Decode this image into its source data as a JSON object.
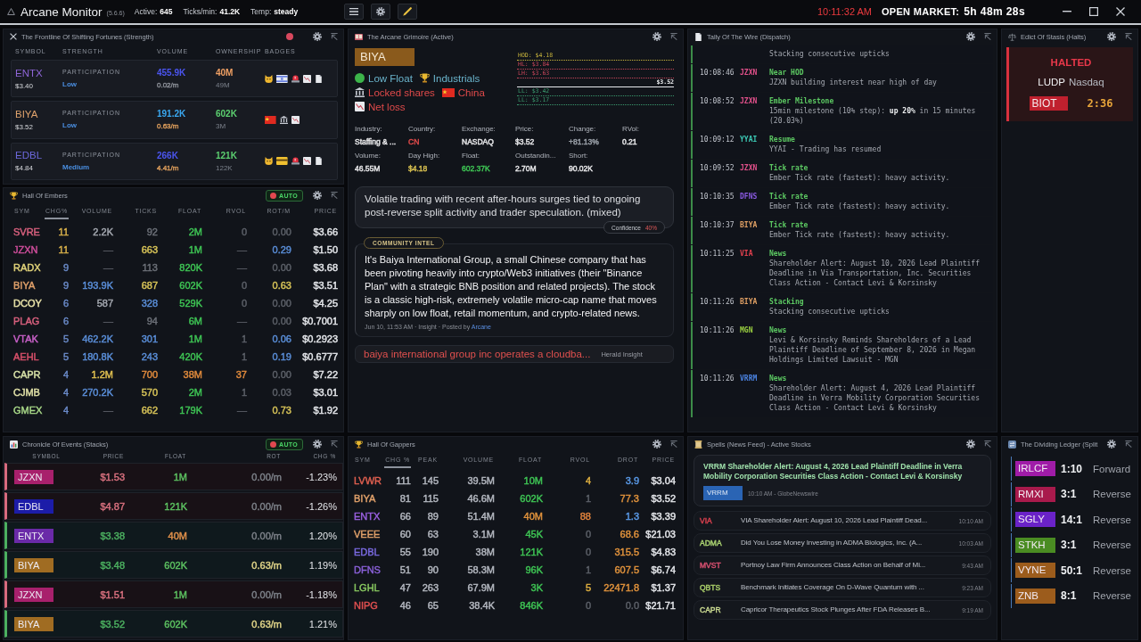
{
  "top_bar": {
    "title": "Arcane Monitor",
    "version": "(5.6.6)",
    "stats": [
      {
        "label": "Active:",
        "value": "645"
      },
      {
        "label": "Ticks/min:",
        "value": "41.2K"
      },
      {
        "label": "Temp:",
        "value": "steady"
      }
    ],
    "tools": [
      {
        "kind": "menu"
      },
      {
        "kind": "gear"
      },
      {
        "kind": "pencil"
      }
    ],
    "clock": "10:11:32 AM",
    "market_label": "OPEN MARKET:",
    "countdown": "5h 48m 28s"
  },
  "frontline": {
    "title": "The Frontline Of Shifting Fortunes (Strength)",
    "columns": [
      "SYMBOL",
      "STRENGTH",
      "VOLUME",
      "OWNERSHIP",
      "BADGES"
    ],
    "rows": [
      {
        "symbol": {
          "text": "ENTX",
          "color": "#8f66d8"
        },
        "price": "$3.40",
        "strength_label": "PARTICIPATION",
        "strength": "Low",
        "volume": {
          "text": "455.9K",
          "color": "#4b55f0"
        },
        "rate": {
          "text": "0.02/m",
          "color": "#8a8e96"
        },
        "ownership": {
          "text": "40M",
          "color": "#f0a064"
        },
        "ownership_sub": "49M",
        "badges": [
          {
            "kind": "cat"
          },
          {
            "kind": "israel"
          },
          {
            "kind": "siren"
          },
          {
            "kind": "chart"
          },
          {
            "kind": "document"
          }
        ]
      },
      {
        "symbol": {
          "text": "BIYA",
          "color": "#dfa26c"
        },
        "price": "$3.52",
        "strength_label": "PARTICIPATION",
        "strength": "Low",
        "volume": {
          "text": "191.2K",
          "color": "#3aa8f0"
        },
        "rate": {
          "text": "0.63/m",
          "color": "#d89a5a"
        },
        "ownership": {
          "text": "602K",
          "color": "#5cd070"
        },
        "ownership_sub": "3M",
        "badges": [
          {
            "kind": "china"
          },
          {
            "kind": "bank"
          },
          {
            "kind": "chart"
          }
        ]
      },
      {
        "symbol": {
          "text": "EDBL",
          "color": "#6c68dc"
        },
        "price": "$4.84",
        "strength_label": "PARTICIPATION",
        "strength": "Medium",
        "volume": {
          "text": "266K",
          "color": "#4b55f0"
        },
        "rate": {
          "text": "4.41/m",
          "color": "#d89a5a"
        },
        "ownership": {
          "text": "121K",
          "color": "#5cd070"
        },
        "ownership_sub": "122K",
        "badges": [
          {
            "kind": "cat"
          },
          {
            "kind": "card"
          },
          {
            "kind": "siren"
          },
          {
            "kind": "chart"
          },
          {
            "kind": "document"
          }
        ]
      }
    ]
  },
  "grimoire": {
    "title": "The Arcane Grimoire (Active)",
    "symbol": {
      "text": "BIYA",
      "color": "#8a5a1c"
    },
    "tags": [
      {
        "kind": "dot",
        "label": "Low Float",
        "color": "#6ab4cc"
      },
      {
        "kind": "trophy",
        "label": "Industrials",
        "color": "#6ab4cc"
      },
      {
        "kind": "bank",
        "label": "Locked shares",
        "color": "#e04a4a"
      },
      {
        "kind": "china",
        "label": "China",
        "color": "#e04a4a"
      },
      {
        "kind": "chart",
        "label": "Net loss",
        "color": "#e04a4a"
      }
    ],
    "levels": [
      {
        "kind": "level",
        "label": "HOD: $4.18",
        "color": "#c8b43c"
      },
      {
        "kind": "level",
        "label": "HL: $3.84",
        "color": "#c8465a"
      },
      {
        "kind": "level",
        "label": "LH: $3.63",
        "color": "#c8465a"
      },
      {
        "kind": "price",
        "label": "$3.52"
      },
      {
        "kind": "level",
        "label": "LL: $3.42",
        "color": "#3a9a6e"
      },
      {
        "kind": "level",
        "label": "LL: $3.17",
        "color": "#3a9a6e"
      }
    ],
    "stats": [
      {
        "label": "Industry:",
        "value": "Staffing & ..."
      },
      {
        "label": "Country:",
        "value": "CN",
        "color": "#e04a4a"
      },
      {
        "label": "Exchange:",
        "value": "NASDAQ"
      },
      {
        "label": "Price:",
        "value": "$3.52"
      },
      {
        "label": "Change:",
        "value": "+81.13%",
        "color": "#9aa0a8"
      },
      {
        "label": "RVol:",
        "value": "0.21"
      },
      {
        "label": "Volume:",
        "value": "46.55M"
      },
      {
        "label": "Day High:",
        "value": "$4.18",
        "color": "#d8c050"
      },
      {
        "label": "Float:",
        "value": "602.37K",
        "color": "#3ec454"
      },
      {
        "label": "Outstandin...",
        "value": "2.70M"
      },
      {
        "label": "Short:",
        "value": "90.02K"
      }
    ],
    "summary": {
      "text": "Volatile trading with recent after-hours surges tied to ongoing post-reverse split activity and trader speculation. (mixed)",
      "confidence_label": "Confidence",
      "confidence": "40%"
    },
    "intel": {
      "badge": "COMMUNITY INTEL",
      "text": "It's Baiya International Group, a small Chinese company that has been pivoting heavily into crypto/Web3 initiatives (their \"Binance Plan\" with a strategic BNB position and related projects). The stock is a classic high-risk, extremely volatile micro-cap name that moves sharply on low float, retail momentum, and crypto-related news.",
      "meta": "Jun 10, 11:53 AM · Insight · Posted by",
      "author": "Arcane"
    },
    "herald": {
      "text": "baiya international group inc operates a cloudba...",
      "source": "Herald Insight"
    }
  },
  "dispatch": {
    "title": "Tally Of The Wire (Dispatch)",
    "entries": [
      {
        "body": "Stacking consecutive upticks"
      },
      {
        "time": "10:08:46",
        "symbol": "JZXN",
        "color": "#e0508a",
        "title": "Near HOD",
        "body": "JZXN building interest near high of day"
      },
      {
        "time": "10:08:52",
        "symbol": "JZXN",
        "color": "#e0508a",
        "title": "Ember Milestone",
        "body": "15min milestone (10% step): **up 20%** in 15 minutes (20.03%)"
      },
      {
        "time": "10:09:12",
        "symbol": "YYAI",
        "color": "#3cc8b4",
        "title": "Resume",
        "body": "YYAI - Trading has resumed"
      },
      {
        "time": "10:09:52",
        "symbol": "JZXN",
        "color": "#e0508a",
        "title": "Tick rate",
        "body": "Ember Tick rate (fastest): heavy activity."
      },
      {
        "time": "10:10:35",
        "symbol": "DFNS",
        "color": "#8a5ae0",
        "title": "Tick rate",
        "body": "Ember Tick rate (fastest): heavy activity."
      },
      {
        "time": "10:10:37",
        "symbol": "BIYA",
        "color": "#e0a064",
        "title": "Tick rate",
        "body": "Ember Tick rate (fastest): heavy activity."
      },
      {
        "time": "10:11:25",
        "symbol": "VIA",
        "color": "#e0404e",
        "title": "News",
        "body": "Shareholder Alert: August 10, 2026 Lead Plaintiff Deadline in Via Transportation, Inc. Securities Class Action - Contact Levi & Korsinsky"
      },
      {
        "time": "10:11:26",
        "symbol": "BIYA",
        "color": "#e0a064",
        "title": "Stacking",
        "body": "Stacking consecutive upticks"
      },
      {
        "time": "10:11:26",
        "symbol": "MGN",
        "color": "#9ad040",
        "title": "News",
        "body": "Levi & Korsinsky Reminds Shareholders of a Lead Plaintiff Deadline of September 8, 2026 in Megan Holdings Limited Lawsuit - MGN"
      },
      {
        "time": "10:11:26",
        "symbol": "VRRM",
        "color": "#4a82e0",
        "title": "News",
        "body": "Shareholder Alert: August 4, 2026 Lead Plaintiff Deadline in Verra Mobility Corporation Securities Class Action - Contact Levi & Korsinsky"
      }
    ]
  },
  "halts": {
    "title": "Edict Of Stasis (Halts)",
    "status": "HALTED",
    "symbol": "LUDP",
    "exchange": "Nasdaq",
    "chip": "BIOT",
    "timer": "2:36"
  },
  "embers": {
    "title": "Hall Of Embers",
    "auto": "AUTO",
    "columns": [
      {
        "label": "SYM",
        "sorted": false
      },
      {
        "label": "CHG%",
        "sorted": true
      },
      {
        "label": "VOLUME",
        "sorted": false
      },
      {
        "label": "TICKS",
        "sorted": false
      },
      {
        "label": "FLOAT",
        "sorted": false
      },
      {
        "label": "RVOL",
        "sorted": false
      },
      {
        "label": "ROT/M",
        "sorted": false
      },
      {
        "label": "PRICE",
        "sorted": false
      }
    ],
    "rows": [
      {
        "cells": [
          {
            "text": "SVRE",
            "color": "#d8607e"
          },
          {
            "text": "11",
            "color": "#d8b04a"
          },
          {
            "text": "2.2K",
            "color": "#a4a8b0"
          },
          {
            "text": "92",
            "color": "#6c7078"
          },
          {
            "text": "2M",
            "color": "#3ec454"
          },
          {
            "text": "0",
            "color": "#5c6068"
          },
          {
            "text": "0.00",
            "color": "#5c6068"
          },
          {
            "text": "$3.66"
          }
        ]
      },
      {
        "cells": [
          {
            "text": "JZXN",
            "color": "#d04e9c"
          },
          {
            "text": "11",
            "color": "#d8b04a"
          },
          {
            "text": "—",
            "color": "#5c6068"
          },
          {
            "text": "663",
            "color": "#d8c458"
          },
          {
            "text": "1M",
            "color": "#3ec454"
          },
          {
            "text": "—",
            "color": "#5c6068"
          },
          {
            "text": "0.29",
            "color": "#5a8ed8"
          },
          {
            "text": "$1.50"
          }
        ]
      },
      {
        "cells": [
          {
            "text": "RADX",
            "color": "#e2d47a"
          },
          {
            "text": "9",
            "color": "#6a8ac8"
          },
          {
            "text": "—",
            "color": "#5c6068"
          },
          {
            "text": "113",
            "color": "#6c7078"
          },
          {
            "text": "820K",
            "color": "#3ec454"
          },
          {
            "text": "—",
            "color": "#5c6068"
          },
          {
            "text": "0.00",
            "color": "#5c6068"
          },
          {
            "text": "$3.68"
          }
        ]
      },
      {
        "cells": [
          {
            "text": "BIYA",
            "color": "#e0a06a"
          },
          {
            "text": "9",
            "color": "#6a8ac8"
          },
          {
            "text": "193.9K",
            "color": "#5a8ed8"
          },
          {
            "text": "687",
            "color": "#d8c458"
          },
          {
            "text": "602K",
            "color": "#3ec454"
          },
          {
            "text": "0",
            "color": "#5c6068"
          },
          {
            "text": "0.63",
            "color": "#d8c458"
          },
          {
            "text": "$3.51"
          }
        ]
      },
      {
        "cells": [
          {
            "text": "DCOY",
            "color": "#e8e2a8"
          },
          {
            "text": "6",
            "color": "#6a8ac8"
          },
          {
            "text": "587",
            "color": "#a4a8b0"
          },
          {
            "text": "328",
            "color": "#5a8ed8"
          },
          {
            "text": "529K",
            "color": "#3ec454"
          },
          {
            "text": "0",
            "color": "#5c6068"
          },
          {
            "text": "0.00",
            "color": "#5c6068"
          },
          {
            "text": "$4.25"
          }
        ]
      },
      {
        "cells": [
          {
            "text": "PLAG",
            "color": "#d8607e"
          },
          {
            "text": "6",
            "color": "#6a8ac8"
          },
          {
            "text": "—",
            "color": "#5c6068"
          },
          {
            "text": "94",
            "color": "#6c7078"
          },
          {
            "text": "6M",
            "color": "#3ec454"
          },
          {
            "text": "—",
            "color": "#5c6068"
          },
          {
            "text": "0.00",
            "color": "#5c6068"
          },
          {
            "text": "$0.7001"
          }
        ]
      },
      {
        "cells": [
          {
            "text": "VTAK",
            "color": "#c860c8"
          },
          {
            "text": "5",
            "color": "#6a8ac8"
          },
          {
            "text": "462.2K",
            "color": "#5a8ed8"
          },
          {
            "text": "301",
            "color": "#5a8ed8"
          },
          {
            "text": "1M",
            "color": "#3ec454"
          },
          {
            "text": "1",
            "color": "#5c6068"
          },
          {
            "text": "0.06",
            "color": "#5a8ed8"
          },
          {
            "text": "$0.2923"
          }
        ]
      },
      {
        "cells": [
          {
            "text": "AEHL",
            "color": "#d8506a"
          },
          {
            "text": "5",
            "color": "#6a8ac8"
          },
          {
            "text": "180.8K",
            "color": "#5a8ed8"
          },
          {
            "text": "243",
            "color": "#5a8ed8"
          },
          {
            "text": "420K",
            "color": "#3ec454"
          },
          {
            "text": "1",
            "color": "#5c6068"
          },
          {
            "text": "0.19",
            "color": "#5a8ed8"
          },
          {
            "text": "$0.6777"
          }
        ]
      },
      {
        "cells": [
          {
            "text": "CAPR",
            "color": "#d8e2a8"
          },
          {
            "text": "4",
            "color": "#6a8ac8"
          },
          {
            "text": "1.2M",
            "color": "#e0c050"
          },
          {
            "text": "700",
            "color": "#e08a3c"
          },
          {
            "text": "38M",
            "color": "#e08a3c"
          },
          {
            "text": "37",
            "color": "#e08a3c"
          },
          {
            "text": "0.00",
            "color": "#5c6068"
          },
          {
            "text": "$7.22"
          }
        ]
      },
      {
        "cells": [
          {
            "text": "CJMB",
            "color": "#e2e2a8"
          },
          {
            "text": "4",
            "color": "#6a8ac8"
          },
          {
            "text": "270.2K",
            "color": "#5a8ed8"
          },
          {
            "text": "570",
            "color": "#d8c458"
          },
          {
            "text": "2M",
            "color": "#3ec454"
          },
          {
            "text": "1",
            "color": "#5c6068"
          },
          {
            "text": "0.03",
            "color": "#5c6068"
          },
          {
            "text": "$3.01"
          }
        ]
      },
      {
        "cells": [
          {
            "text": "GMEX",
            "color": "#a8d888"
          },
          {
            "text": "4",
            "color": "#6a8ac8"
          },
          {
            "text": "—",
            "color": "#5c6068"
          },
          {
            "text": "662",
            "color": "#d8c458"
          },
          {
            "text": "179K",
            "color": "#3ec454"
          },
          {
            "text": "—",
            "color": "#5c6068"
          },
          {
            "text": "0.73",
            "color": "#d8c458"
          },
          {
            "text": "$1.92"
          }
        ]
      }
    ]
  },
  "chronicle": {
    "title": "Chronicle Of Events (Stacks)",
    "auto": "AUTO",
    "columns": [
      "SYMBOL",
      "PRICE",
      "FLOAT",
      "ROT",
      "CHG %"
    ],
    "rows": [
      {
        "kind": "down",
        "symbol": {
          "text": "JZXN",
          "color": "#a8206c"
        },
        "price": {
          "text": "$1.53",
          "color": "#d8707e"
        },
        "float": {
          "text": "1M",
          "color": "#5cc060"
        },
        "rot": {
          "text": "0.00/m",
          "color": "#7c8088"
        },
        "change": "-1.23%"
      },
      {
        "kind": "down",
        "symbol": {
          "text": "EDBL",
          "color": "#1c1ca8"
        },
        "price": {
          "text": "$4.87",
          "color": "#d8707e"
        },
        "float": {
          "text": "121K",
          "color": "#5cc060"
        },
        "rot": {
          "text": "0.00/m",
          "color": "#7c8088"
        },
        "change": "-1.26%"
      },
      {
        "kind": "up",
        "symbol": {
          "text": "ENTX",
          "color": "#6a2aa8"
        },
        "price": {
          "text": "$3.38",
          "color": "#4cb060"
        },
        "float": {
          "text": "40M",
          "color": "#e0904a"
        },
        "rot": {
          "text": "0.00/m",
          "color": "#7c8088"
        },
        "change": "1.20%"
      },
      {
        "kind": "up",
        "symbol": {
          "text": "BIYA",
          "color": "#a06c22"
        },
        "price": {
          "text": "$3.48",
          "color": "#4cb060"
        },
        "float": {
          "text": "602K",
          "color": "#5cc060"
        },
        "rot": {
          "text": "0.63/m",
          "color": "#e0d488"
        },
        "change": "1.19%"
      },
      {
        "kind": "down",
        "symbol": {
          "text": "JZXN",
          "color": "#a8206c"
        },
        "price": {
          "text": "$1.51",
          "color": "#d8707e"
        },
        "float": {
          "text": "1M",
          "color": "#5cc060"
        },
        "rot": {
          "text": "0.00/m",
          "color": "#7c8088"
        },
        "change": "-1.18%"
      },
      {
        "kind": "up",
        "symbol": {
          "text": "BIYA",
          "color": "#a06c22"
        },
        "price": {
          "text": "$3.52",
          "color": "#4cb060"
        },
        "float": {
          "text": "602K",
          "color": "#5cc060"
        },
        "rot": {
          "text": "0.63/m",
          "color": "#e0d488"
        },
        "change": "1.21%"
      }
    ]
  },
  "gappers": {
    "title": "Hall Of Gappers",
    "columns": [
      {
        "label": "SYM",
        "sorted": false
      },
      {
        "label": "CHG %",
        "sorted": true
      },
      {
        "label": "PEAK",
        "sorted": false
      },
      {
        "label": "VOLUME",
        "sorted": false
      },
      {
        "label": "FLOAT",
        "sorted": false
      },
      {
        "label": "RVOL",
        "sorted": false
      },
      {
        "label": "DROT",
        "sorted": false
      },
      {
        "label": "PRICE",
        "sorted": false
      }
    ],
    "rows": [
      {
        "cells": [
          {
            "text": "LVWR",
            "color": "#e06050"
          },
          {
            "text": "111"
          },
          {
            "text": "145"
          },
          {
            "text": "39.5M"
          },
          {
            "text": "10M",
            "color": "#3ec454"
          },
          {
            "text": "4",
            "color": "#e0b040"
          },
          {
            "text": "3.9",
            "color": "#5a9ae8"
          },
          {
            "text": "$3.04"
          }
        ]
      },
      {
        "cells": [
          {
            "text": "BIYA",
            "color": "#e0a06a"
          },
          {
            "text": "81"
          },
          {
            "text": "115"
          },
          {
            "text": "46.6M"
          },
          {
            "text": "602K",
            "color": "#3ec454"
          },
          {
            "text": "1",
            "color": "#5c6068"
          },
          {
            "text": "77.3",
            "color": "#e0923c"
          },
          {
            "text": "$3.52"
          }
        ]
      },
      {
        "cells": [
          {
            "text": "ENTX",
            "color": "#9a60e0"
          },
          {
            "text": "66"
          },
          {
            "text": "89"
          },
          {
            "text": "51.4M"
          },
          {
            "text": "40M",
            "color": "#e0923c"
          },
          {
            "text": "88",
            "color": "#e0823c"
          },
          {
            "text": "1.3",
            "color": "#5a9ae8"
          },
          {
            "text": "$3.39"
          }
        ]
      },
      {
        "cells": [
          {
            "text": "VEEE",
            "color": "#e0a06a"
          },
          {
            "text": "60"
          },
          {
            "text": "63"
          },
          {
            "text": "3.1M"
          },
          {
            "text": "45K",
            "color": "#3ec454"
          },
          {
            "text": "0",
            "color": "#5c6068"
          },
          {
            "text": "68.6",
            "color": "#e0923c"
          },
          {
            "text": "$21.03"
          }
        ]
      },
      {
        "cells": [
          {
            "text": "EDBL",
            "color": "#7a6ae0"
          },
          {
            "text": "55"
          },
          {
            "text": "190"
          },
          {
            "text": "38M"
          },
          {
            "text": "121K",
            "color": "#3ec454"
          },
          {
            "text": "0",
            "color": "#5c6068"
          },
          {
            "text": "315.5",
            "color": "#e0923c"
          },
          {
            "text": "$4.83"
          }
        ]
      },
      {
        "cells": [
          {
            "text": "DFNS",
            "color": "#8a60d8"
          },
          {
            "text": "51"
          },
          {
            "text": "90"
          },
          {
            "text": "58.3M"
          },
          {
            "text": "96K",
            "color": "#3ec454"
          },
          {
            "text": "1",
            "color": "#5c6068"
          },
          {
            "text": "607.5",
            "color": "#e0923c"
          },
          {
            "text": "$6.74"
          }
        ]
      },
      {
        "cells": [
          {
            "text": "LGHL",
            "color": "#88c860"
          },
          {
            "text": "47"
          },
          {
            "text": "263"
          },
          {
            "text": "67.9M"
          },
          {
            "text": "3K",
            "color": "#3ec454"
          },
          {
            "text": "5",
            "color": "#e0b040"
          },
          {
            "text": "22471.8",
            "color": "#e0923c"
          },
          {
            "text": "$1.37"
          }
        ]
      },
      {
        "cells": [
          {
            "text": "NIPG",
            "color": "#e05050"
          },
          {
            "text": "46"
          },
          {
            "text": "65"
          },
          {
            "text": "38.4K"
          },
          {
            "text": "846K",
            "color": "#3ec454"
          },
          {
            "text": "0",
            "color": "#5c6068"
          },
          {
            "text": "0.0",
            "color": "#5c6068"
          },
          {
            "text": "$21.71"
          }
        ]
      }
    ]
  },
  "news": {
    "title": "Spells (News Feed) - Active Stocks",
    "featured": {
      "headline": "VRRM Shareholder Alert: August 4, 2026 Lead Plaintiff Deadline in Verra Mobility Corporation Securities Class Action - Contact Levi & Korsinsky",
      "symbol": "VRRM",
      "color": "#2a64b4",
      "meta": "10:10 AM - GlobeNewswire"
    },
    "items": [
      {
        "symbol": "VIA",
        "color": "#d8404e",
        "headline": "VIA Shareholder Alert: August 10, 2026 Lead Plaintiff Dead...",
        "time": "10:10 AM"
      },
      {
        "symbol": "ADMA",
        "color": "#a8d070",
        "headline": "Did You Lose Money Investing in ADMA Biologics, Inc. (A...",
        "time": "10:03 AM"
      },
      {
        "symbol": "MVST",
        "color": "#d85070",
        "headline": "Portnoy Law Firm Announces Class Action on Behalf of Mi...",
        "time": "9:43 AM"
      },
      {
        "symbol": "QBTS",
        "color": "#a8cc68",
        "headline": "Benchmark Initiates Coverage On D-Wave Quantum with ...",
        "time": "9:23 AM"
      },
      {
        "symbol": "CAPR",
        "color": "#c8d890",
        "headline": "Capricor Therapeutics Stock Plunges After FDA Releases B...",
        "time": "9:19 AM"
      }
    ]
  },
  "splits": {
    "title": "The Dividing Ledger (Split",
    "rows": [
      {
        "symbol": "IRLCF",
        "color": "#a01ca8",
        "ratio": "1:10",
        "type": "Forward"
      },
      {
        "symbol": "RMXI",
        "color": "#a81a4c",
        "ratio": "3:1",
        "type": "Reverse"
      },
      {
        "symbol": "SGLY",
        "color": "#6a22c8",
        "ratio": "14:1",
        "type": "Reverse"
      },
      {
        "symbol": "STKH",
        "color": "#4a8c22",
        "ratio": "3:1",
        "type": "Reverse"
      },
      {
        "symbol": "VYNE",
        "color": "#9c5c1c",
        "ratio": "50:1",
        "type": "Reverse"
      },
      {
        "symbol": "ZNB",
        "color": "#9c5c1c",
        "ratio": "8:1",
        "type": "Reverse"
      }
    ]
  }
}
